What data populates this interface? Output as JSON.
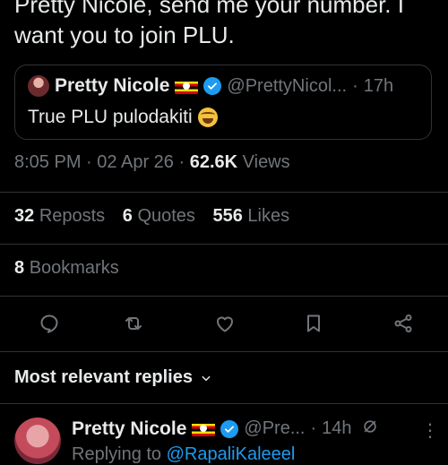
{
  "tweet": {
    "text": "Pretty Nicole, send me your number. I want you to join PLU."
  },
  "quote": {
    "name": "Pretty Nicole",
    "handle": "@PrettyNicol...",
    "dot": "·",
    "time": "17h",
    "text": "True PLU pulodakiti"
  },
  "meta": {
    "time": "8:05 PM",
    "sep1": "·",
    "date": "02 Apr 26",
    "sep2": "·",
    "views_count": "62.6K",
    "views_label": "Views"
  },
  "stats": {
    "reposts_count": "32",
    "reposts_label": "Reposts",
    "quotes_count": "6",
    "quotes_label": "Quotes",
    "likes_count": "556",
    "likes_label": "Likes",
    "bookmarks_count": "8",
    "bookmarks_label": "Bookmarks"
  },
  "actions": {
    "icons": [
      "reply-icon",
      "repost-icon",
      "like-icon",
      "bookmark-icon",
      "share-icon"
    ]
  },
  "replies": {
    "heading": "Most relevant replies"
  },
  "reply": {
    "name": "Pretty Nicole",
    "handle": "@Pre...",
    "dot": "·",
    "time": "14h",
    "more": "⋮",
    "text_prefix": "Replying to",
    "text_link": "@RapaliKaleeel"
  },
  "colors": {
    "background": "#000000",
    "text": "#e7e9ea",
    "muted": "#71767b",
    "accent": "#1d9bf0",
    "border": "#2f3336"
  }
}
